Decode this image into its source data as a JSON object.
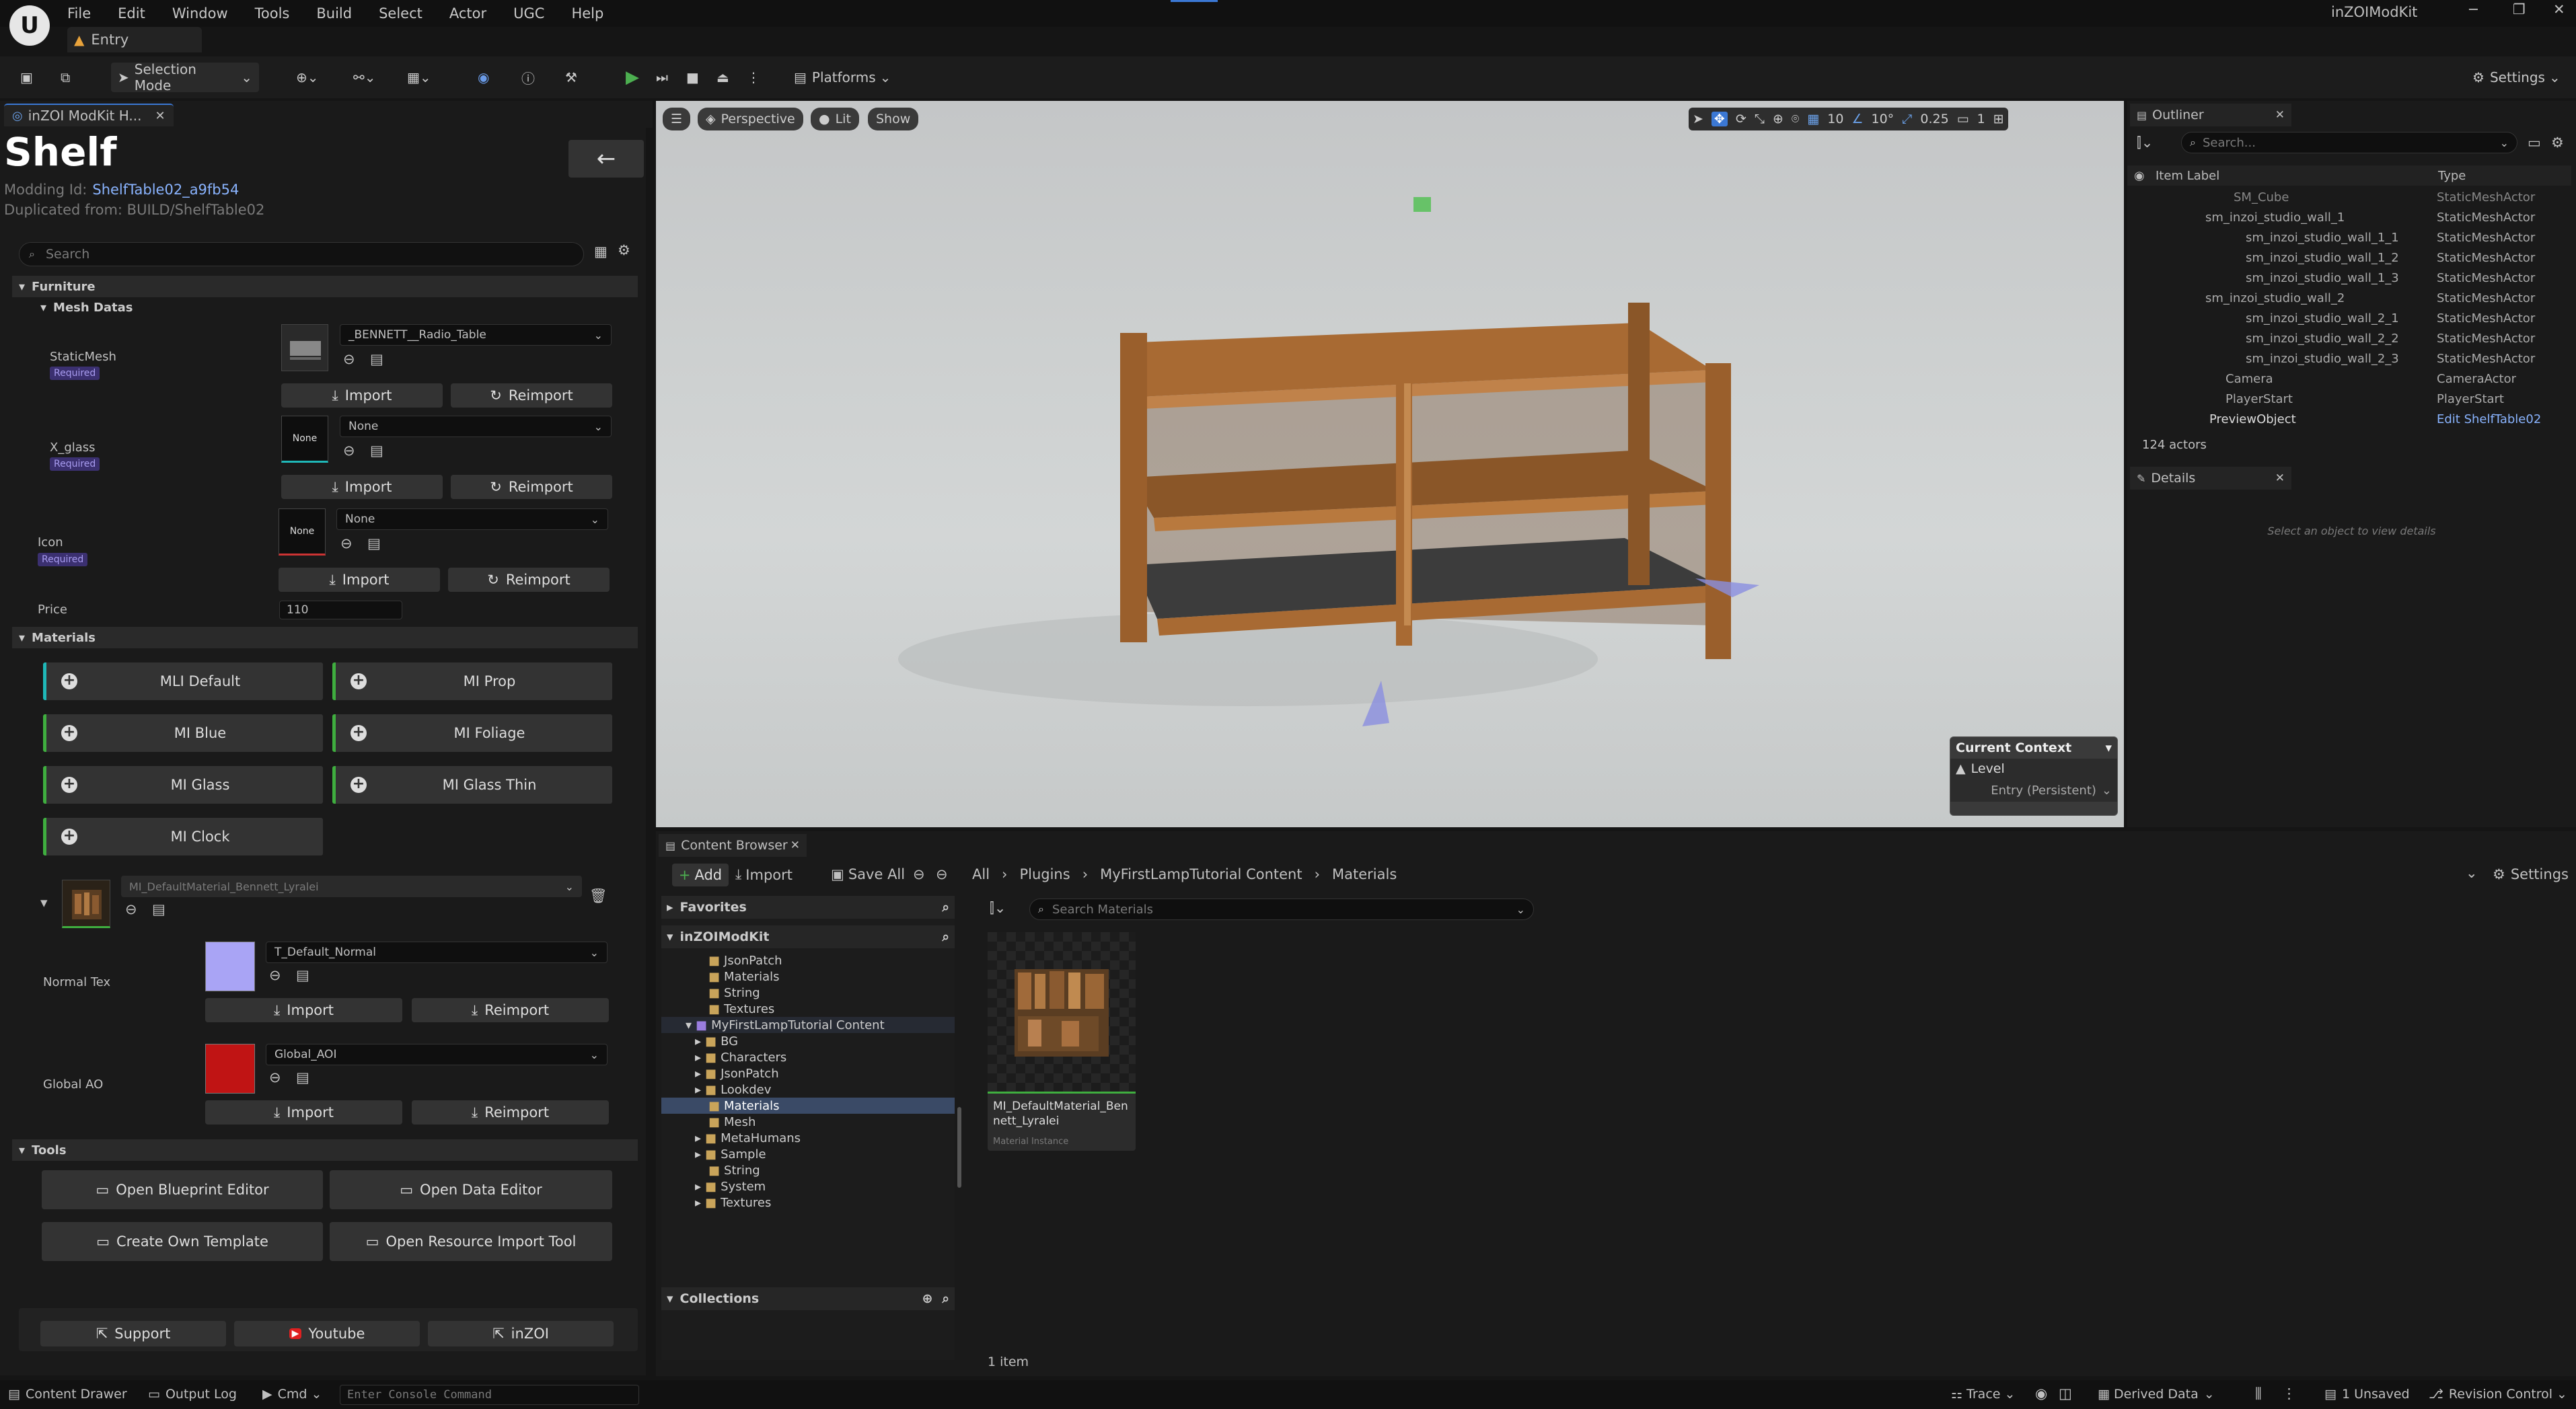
{
  "app": {
    "title": "inZOIModKit",
    "level_tab": "Entry"
  },
  "menu": [
    "File",
    "Edit",
    "Window",
    "Tools",
    "Build",
    "Select",
    "Actor",
    "UGC",
    "Help"
  ],
  "toolbar": {
    "selection_mode": "Selection Mode",
    "platforms": "Platforms",
    "settings": "Settings"
  },
  "left_panel": {
    "tab_title": "inZOI ModKit H...",
    "title": "Shelf",
    "modding_id_label": "Modding Id:",
    "modding_id": "ShelfTable02_a9fb54",
    "duplicated_from": "Duplicated from: BUILD/ShelfTable02",
    "search_placeholder": "Search",
    "furniture_section": "Furniture",
    "mesh_datas": "Mesh Datas",
    "required": "Required",
    "static_mesh": {
      "label": "StaticMesh",
      "value": "_BENNETT__Radio_Table"
    },
    "x_glass": {
      "label": "X_glass",
      "value": "None",
      "thumb": "None"
    },
    "icon": {
      "label": "Icon",
      "value": "None",
      "thumb": "None"
    },
    "import": "Import",
    "reimport": "Reimport",
    "price_label": "Price",
    "price": "110",
    "materials_section": "Materials",
    "materials": [
      "MLI Default",
      "MI Prop",
      "MI Blue",
      "MI Foliage",
      "MI Glass",
      "MI Glass Thin",
      "MI Clock"
    ],
    "material_instance": "MI_DefaultMaterial_Bennett_Lyralei",
    "normal_tex": {
      "label": "Normal Tex",
      "value": "T_Default_Normal"
    },
    "global_ao": {
      "label": "Global AO",
      "value": "Global_AOI"
    },
    "tools_section": "Tools",
    "tools": [
      "Open Blueprint Editor",
      "Open Data Editor",
      "Create Own Template",
      "Open Resource Import Tool"
    ],
    "links": [
      "Support",
      "Youtube",
      "inZOI"
    ]
  },
  "viewport": {
    "perspective": "Perspective",
    "lit": "Lit",
    "show": "Show",
    "grid": "10",
    "angle": "10°",
    "scale": "0.25",
    "cam": "1",
    "context_title": "Current Context",
    "context_level": "Level",
    "context_value": "Entry (Persistent)"
  },
  "outliner": {
    "title": "Outliner",
    "search_placeholder": "Search...",
    "col_label": "Item Label",
    "col_type": "Type",
    "rows": [
      {
        "label": "SM_Cube",
        "type": "StaticMeshActor"
      },
      {
        "label": "sm_inzoi_studio_wall_1",
        "type": "StaticMeshActor"
      },
      {
        "label": "sm_inzoi_studio_wall_1_1",
        "type": "StaticMeshActor"
      },
      {
        "label": "sm_inzoi_studio_wall_1_2",
        "type": "StaticMeshActor"
      },
      {
        "label": "sm_inzoi_studio_wall_1_3",
        "type": "StaticMeshActor"
      },
      {
        "label": "sm_inzoi_studio_wall_2",
        "type": "StaticMeshActor"
      },
      {
        "label": "sm_inzoi_studio_wall_2_1",
        "type": "StaticMeshActor"
      },
      {
        "label": "sm_inzoi_studio_wall_2_2",
        "type": "StaticMeshActor"
      },
      {
        "label": "sm_inzoi_studio_wall_2_3",
        "type": "StaticMeshActor"
      },
      {
        "label": "Camera",
        "type": "CameraActor"
      },
      {
        "label": "PlayerStart",
        "type": "PlayerStart"
      },
      {
        "label": "PreviewObject",
        "type": "Edit ShelfTable02"
      }
    ],
    "count": "124 actors"
  },
  "details": {
    "title": "Details",
    "empty": "Select an object to view details"
  },
  "content_browser": {
    "title": "Content Browser",
    "add": "Add",
    "import": "Import",
    "save_all": "Save All",
    "path": [
      "All",
      "Plugins",
      "MyFirstLampTutorial Content",
      "Materials"
    ],
    "settings": "Settings",
    "favorites": "Favorites",
    "root": "inZOIModKit",
    "search_placeholder": "Search Materials",
    "tree": [
      "JsonPatch",
      "Materials",
      "String",
      "Textures",
      "MyFirstLampTutorial Content",
      "BG",
      "Characters",
      "JsonPatch",
      "Lookdev",
      "Materials",
      "Mesh",
      "MetaHumans",
      "Sample",
      "String",
      "System",
      "Textures"
    ],
    "collections": "Collections",
    "asset_name": "MI_DefaultMaterial_Bennett_Lyralei",
    "asset_type": "Material Instance",
    "item_count": "1 item"
  },
  "statusbar": {
    "content_drawer": "Content Drawer",
    "output_log": "Output Log",
    "cmd": "Cmd",
    "console_placeholder": "Enter Console Command",
    "trace": "Trace",
    "derived_data": "Derived Data",
    "unsaved": "1 Unsaved",
    "revision_control": "Revision Control"
  },
  "colors": {
    "accent_blue": "#3b78d4",
    "green_play": "#4caf50",
    "required_purple": "#a89cf0",
    "link_blue": "#8ab4ff"
  }
}
